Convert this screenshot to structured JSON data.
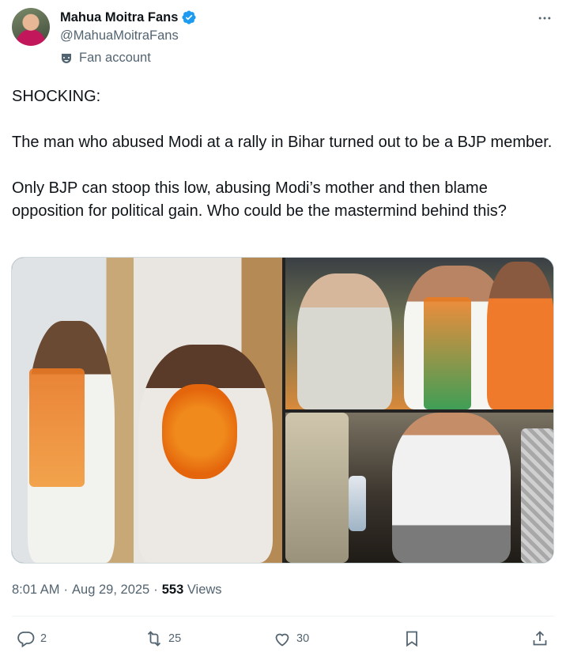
{
  "author": {
    "name": "Mahua Moitra Fans",
    "handle": "@MahuaMoitraFans",
    "account_label": "Fan account",
    "verified_color": "#1d9bf0"
  },
  "tweet": {
    "lines": [
      "SHOCKING:",
      "The man who abused Modi at a rally in Bihar turned out to be a BJP member.",
      "Only BJP can stoop this low, abusing Modi’s mother and then blame opposition for political gain. Who could be the mastermind behind this?"
    ]
  },
  "media": {
    "images": [
      {
        "name": "photo-garland-handshake"
      },
      {
        "name": "photo-group-with-scarves"
      },
      {
        "name": "photo-man-in-vest"
      }
    ]
  },
  "meta": {
    "time": "8:01 AM",
    "separator": "·",
    "date": "Aug 29, 2025",
    "views_count": "553",
    "views_label": "Views"
  },
  "actions": {
    "replies": "2",
    "reposts": "25",
    "likes": "30"
  },
  "icons": [
    "verified-badge-icon",
    "fan-mask-icon",
    "more-icon",
    "reply-icon",
    "repost-icon",
    "like-icon",
    "bookmark-icon",
    "share-icon"
  ]
}
